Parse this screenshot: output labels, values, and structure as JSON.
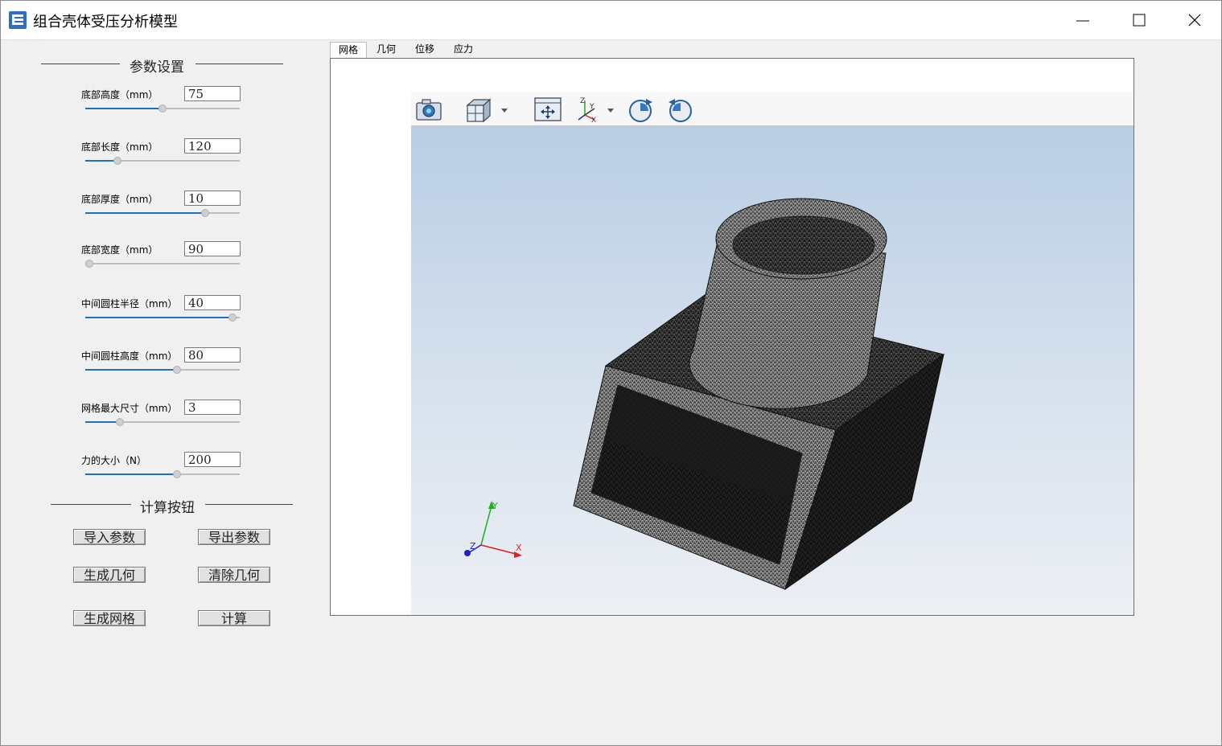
{
  "window": {
    "title": "组合壳体受压分析模型"
  },
  "params": {
    "header": "参数设置",
    "items": [
      {
        "label": "底部高度（mm）",
        "value": "75",
        "slider": 0.5
      },
      {
        "label": "底部长度（mm）",
        "value": "120",
        "slider": 0.19
      },
      {
        "label": "底部厚度（mm）",
        "value": "10",
        "slider": 0.79
      },
      {
        "label": "底部宽度（mm）",
        "value": "90",
        "slider": 0.0
      },
      {
        "label": "中间圆柱半径（mm）",
        "value": "40",
        "slider": 0.98
      },
      {
        "label": "中间圆柱高度（mm）",
        "value": "80",
        "slider": 0.6
      },
      {
        "label": "网格最大尺寸（mm）",
        "value": "3",
        "slider": 0.21
      },
      {
        "label": "力的大小（N）",
        "value": "200",
        "slider": 0.6
      }
    ]
  },
  "actions": {
    "header": "计算按钮",
    "import": "导入参数",
    "export": "导出参数",
    "gen_geometry": "生成几何",
    "clear_geometry": "清除几何",
    "gen_mesh": "生成网格",
    "compute": "计算"
  },
  "tabs": [
    "网格",
    "几何",
    "位移",
    "应力"
  ],
  "viewer": {
    "tools": [
      "camera-icon",
      "view-cube-icon",
      "fit-all-icon",
      "axis-orientation-icon",
      "rotate-cw-icon",
      "rotate-ccw-icon"
    ],
    "axis_labels": {
      "x": "X",
      "y": "Y",
      "z": "Z"
    },
    "axis_tool_labels": {
      "x": "X",
      "y": "Y",
      "z": "Z"
    }
  }
}
